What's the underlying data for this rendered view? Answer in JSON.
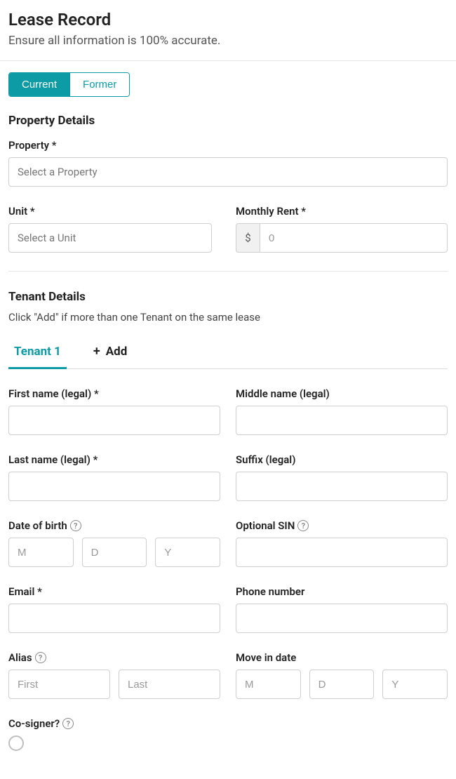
{
  "header": {
    "title": "Lease Record",
    "subtitle": "Ensure all information is 100% accurate."
  },
  "segmented": {
    "current": "Current",
    "former": "Former"
  },
  "property": {
    "section_title": "Property Details",
    "property_label": "Property *",
    "property_placeholder": "Select a Property",
    "unit_label": "Unit *",
    "unit_placeholder": "Select a Unit",
    "rent_label": "Monthly Rent *",
    "rent_prefix": "$",
    "rent_placeholder": "0"
  },
  "tenant": {
    "section_title": "Tenant Details",
    "section_sub": "Click \"Add\" if more than one Tenant on the same lease",
    "tab_active": "Tenant 1",
    "tab_add": "Add",
    "first_name_label": "First name (legal)  *",
    "middle_name_label": "Middle name (legal)",
    "last_name_label": "Last name (legal)  *",
    "suffix_label": "Suffix (legal)",
    "dob_label": "Date of birth",
    "dob_m": "M",
    "dob_d": "D",
    "dob_y": "Y",
    "sin_label": "Optional SIN",
    "email_label": "Email  *",
    "phone_label": "Phone number",
    "alias_label": "Alias",
    "alias_first": "First",
    "alias_last": "Last",
    "movein_label": "Move in date",
    "movein_m": "M",
    "movein_d": "D",
    "movein_y": "Y",
    "cosigner_label": "Co-signer?"
  }
}
